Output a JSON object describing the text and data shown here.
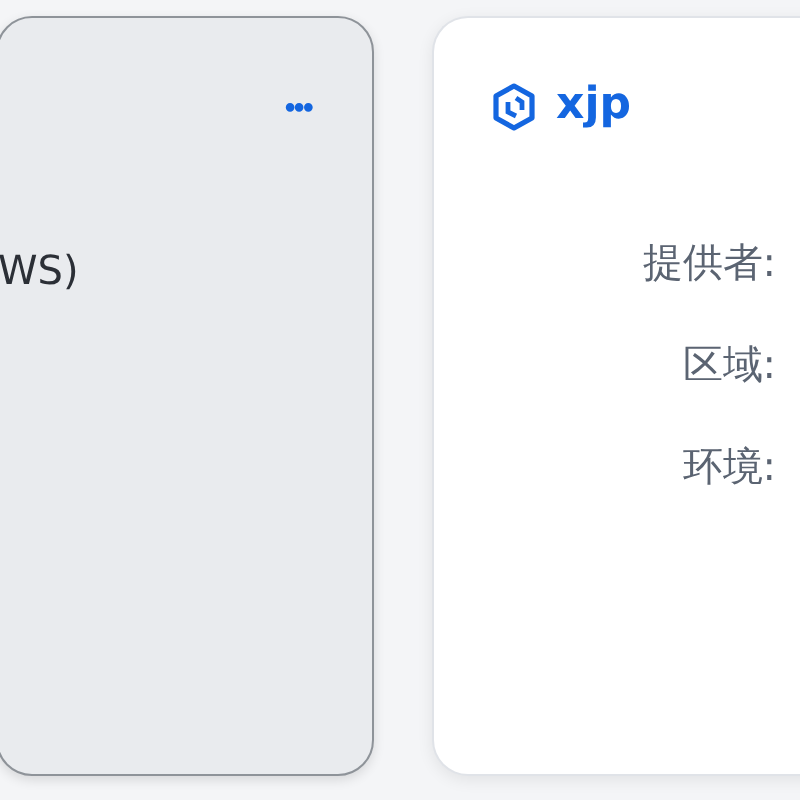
{
  "cards": [
    {
      "menu": "•••",
      "lines": [
        "WS)"
      ]
    },
    {
      "title": "xjp",
      "fields": [
        {
          "label": "提供者:"
        },
        {
          "label": "区域:"
        },
        {
          "label": "环境:"
        }
      ]
    }
  ]
}
